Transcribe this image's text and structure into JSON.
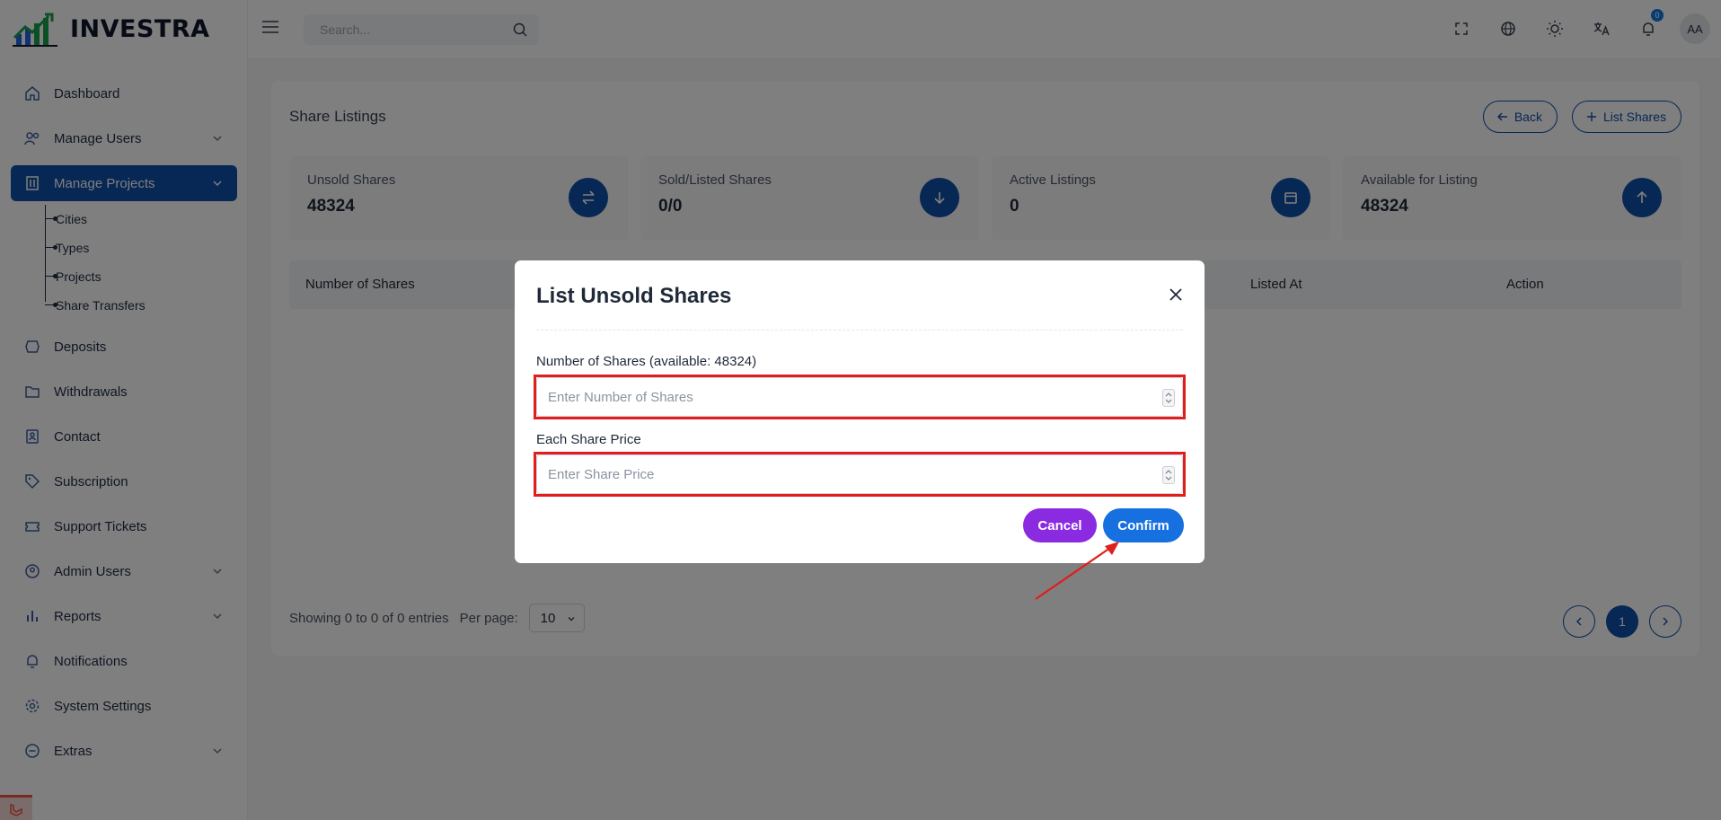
{
  "app": {
    "brand": "INVESTRA"
  },
  "sidebar": {
    "items": [
      {
        "label": "Dashboard",
        "icon": "home-icon",
        "expandable": false
      },
      {
        "label": "Manage Users",
        "icon": "users-icon",
        "expandable": true
      },
      {
        "label": "Manage Projects",
        "icon": "building-icon",
        "expandable": true,
        "active": true
      },
      {
        "label": "Deposits",
        "icon": "deposit-icon",
        "expandable": false
      },
      {
        "label": "Withdrawals",
        "icon": "folder-icon",
        "expandable": false
      },
      {
        "label": "Contact",
        "icon": "contact-icon",
        "expandable": false
      },
      {
        "label": "Subscription",
        "icon": "tag-icon",
        "expandable": false
      },
      {
        "label": "Support Tickets",
        "icon": "ticket-icon",
        "expandable": false
      },
      {
        "label": "Admin Users",
        "icon": "user-circle-icon",
        "expandable": true
      },
      {
        "label": "Reports",
        "icon": "bar-chart-icon",
        "expandable": true
      },
      {
        "label": "Notifications",
        "icon": "bell-icon",
        "expandable": false
      },
      {
        "label": "System Settings",
        "icon": "gear-icon",
        "expandable": false
      },
      {
        "label": "Extras",
        "icon": "minus-circle-icon",
        "expandable": true
      }
    ],
    "sub_items": [
      "Cities",
      "Types",
      "Projects",
      "Share Transfers"
    ]
  },
  "topbar": {
    "search_placeholder": "Search...",
    "notification_count": "0",
    "avatar_initials": "AA"
  },
  "page": {
    "title": "Share Listings",
    "back_label": "Back",
    "list_shares_label": "List Shares",
    "stats": [
      {
        "label": "Unsold Shares",
        "value": "48324",
        "icon": "swap-icon"
      },
      {
        "label": "Sold/Listed Shares",
        "value": "0/0",
        "icon": "arrow-down-icon"
      },
      {
        "label": "Active Listings",
        "value": "0",
        "icon": "calendar-icon"
      },
      {
        "label": "Available for Listing",
        "value": "48324",
        "icon": "arrow-up-icon"
      }
    ],
    "table_headers": {
      "shares": "Number of Shares",
      "listed_at": "Listed At",
      "action": "Action"
    },
    "footer": {
      "showing": "Showing 0 to 0 of 0 entries",
      "per_page_label": "Per page:",
      "per_page_value": "10",
      "current_page": "1"
    }
  },
  "modal": {
    "title": "List Unsold Shares",
    "shares_label": "Number of Shares (available: 48324)",
    "shares_placeholder": "Enter Number of Shares",
    "price_label": "Each Share Price",
    "price_placeholder": "Enter Share Price",
    "cancel_label": "Cancel",
    "confirm_label": "Confirm"
  },
  "colors": {
    "primary": "#0e4fa8",
    "confirm": "#1670e0",
    "cancel": "#8a2be2",
    "annotation": "#e11d1d"
  }
}
